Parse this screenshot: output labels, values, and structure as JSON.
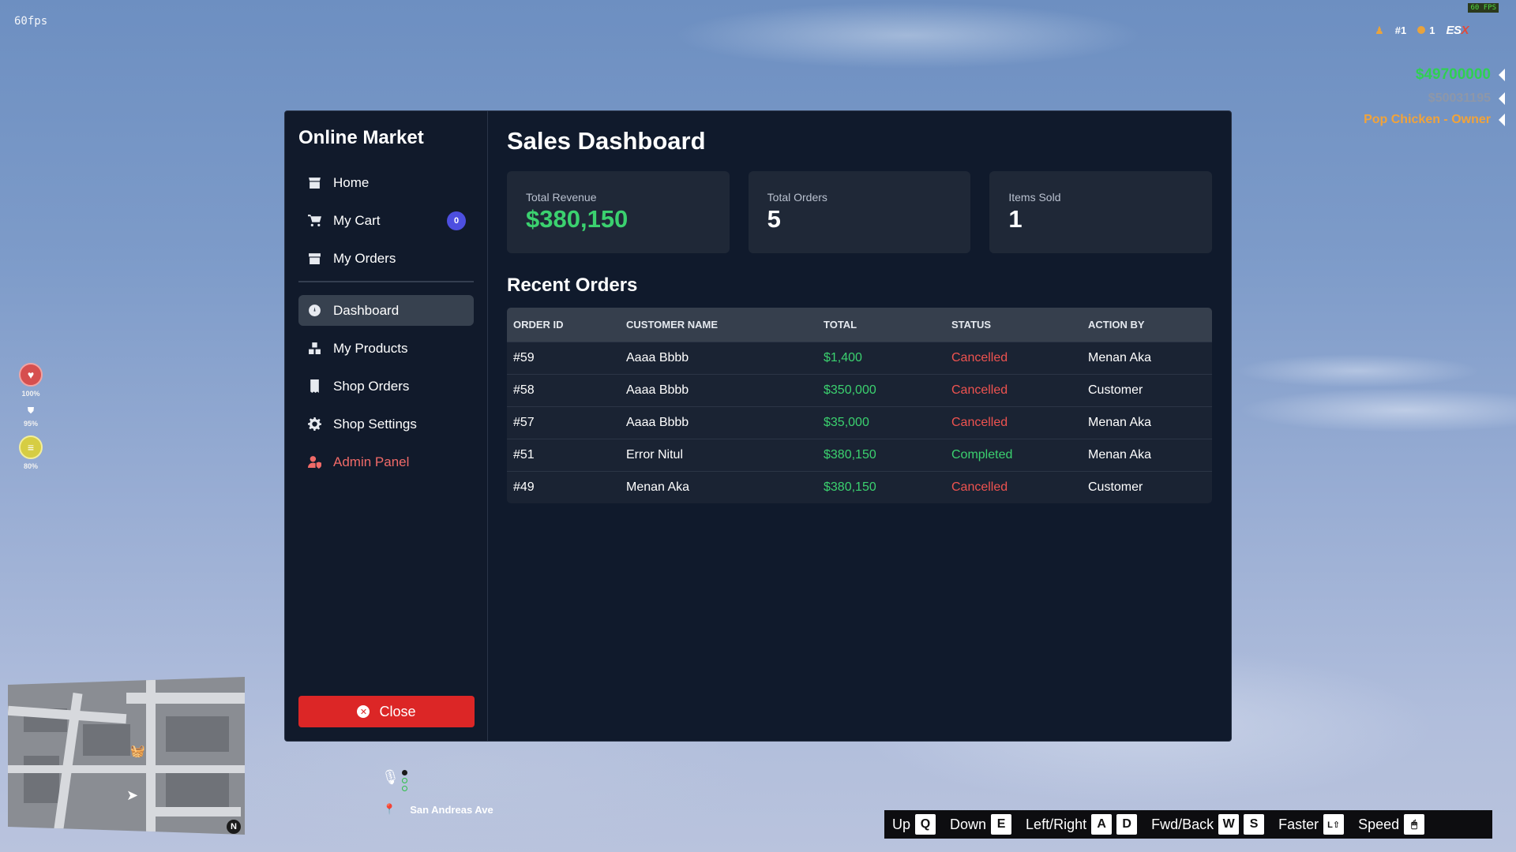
{
  "hud": {
    "fps_text": "60fps",
    "fps_badge": "60 FPS",
    "server_id": "#1",
    "online_count": "1",
    "framework_logo": "ESX",
    "cash": "$49700000",
    "bank": "$50031195",
    "job": "Pop Chicken - Owner",
    "health_pct": "100%",
    "armor_pct": "95%",
    "stamina_pct": "80%",
    "compass": "N",
    "street": "San Andreas Ave",
    "keybar": [
      {
        "label": "Up",
        "keys": [
          "Q"
        ]
      },
      {
        "label": "Down",
        "keys": [
          "E"
        ]
      },
      {
        "label": "Left/Right",
        "keys": [
          "A",
          "D"
        ]
      },
      {
        "label": "Fwd/Back",
        "keys": [
          "W",
          "S"
        ]
      },
      {
        "label": "Faster",
        "keys": [
          "L⇧"
        ]
      },
      {
        "label": "Speed",
        "keys": [
          "🖱"
        ]
      }
    ]
  },
  "sidebar": {
    "brand": "Online Market",
    "items": [
      {
        "id": "home",
        "label": "Home",
        "icon": "store-icon"
      },
      {
        "id": "cart",
        "label": "My Cart",
        "icon": "cart-icon",
        "badge": "0"
      },
      {
        "id": "orders",
        "label": "My Orders",
        "icon": "box-icon"
      },
      {
        "id": "dashboard",
        "label": "Dashboard",
        "icon": "gauge-icon",
        "active": true
      },
      {
        "id": "products",
        "label": "My Products",
        "icon": "boxes-icon"
      },
      {
        "id": "shop-orders",
        "label": "Shop Orders",
        "icon": "receipt-icon"
      },
      {
        "id": "settings",
        "label": "Shop Settings",
        "icon": "gear-icon"
      },
      {
        "id": "admin",
        "label": "Admin Panel",
        "icon": "user-shield-icon"
      }
    ],
    "close_label": "Close"
  },
  "main": {
    "title": "Sales Dashboard",
    "stats": [
      {
        "label": "Total Revenue",
        "value": "$380,150"
      },
      {
        "label": "Total Orders",
        "value": "5"
      },
      {
        "label": "Items Sold",
        "value": "1"
      }
    ],
    "recent_title": "Recent Orders",
    "columns": [
      "ORDER ID",
      "CUSTOMER NAME",
      "TOTAL",
      "STATUS",
      "ACTION BY"
    ],
    "rows": [
      {
        "id": "#59",
        "customer": "Aaaa Bbbb",
        "total": "$1,400",
        "status": "Cancelled",
        "by": "Menan Aka"
      },
      {
        "id": "#58",
        "customer": "Aaaa Bbbb",
        "total": "$350,000",
        "status": "Cancelled",
        "by": "Customer"
      },
      {
        "id": "#57",
        "customer": "Aaaa Bbbb",
        "total": "$35,000",
        "status": "Cancelled",
        "by": "Menan Aka"
      },
      {
        "id": "#51",
        "customer": "Error Nitul",
        "total": "$380,150",
        "status": "Completed",
        "by": "Menan Aka"
      },
      {
        "id": "#49",
        "customer": "Menan Aka",
        "total": "$380,150",
        "status": "Cancelled",
        "by": "Customer"
      }
    ],
    "colors": {
      "positive": "#3bd16f",
      "negative": "#ef5350",
      "accent": "#4d4fe0",
      "danger": "#dc2626"
    }
  }
}
